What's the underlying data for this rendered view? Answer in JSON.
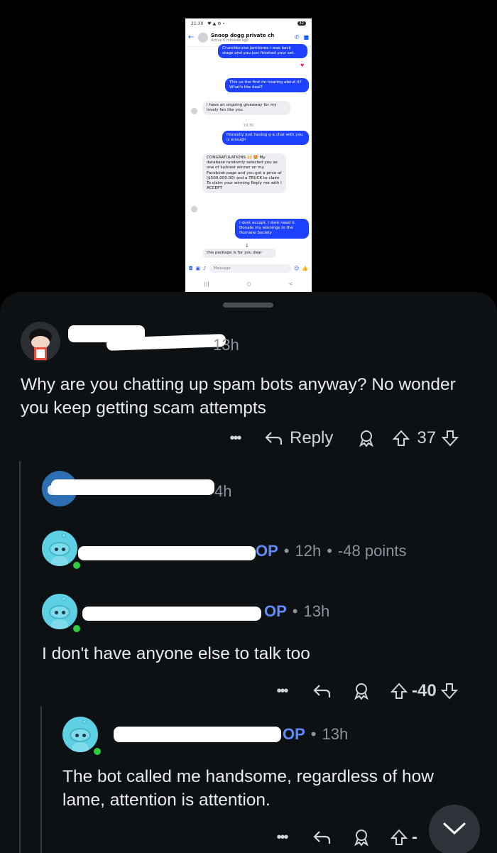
{
  "phone": {
    "status_time": "21:30",
    "status_icons": "♥ ▲ ⚙ •",
    "battery": "42",
    "contact_name": "Snoop dogg private ch",
    "contact_status": "Active 6 minutes ago",
    "messages": [
      {
        "dir": "out",
        "text": "Crunchbruise Jamboree I was back stage and you just finished your set."
      },
      {
        "dir": "out",
        "text": "This us the first im hearing about it? What's the deal?"
      },
      {
        "dir": "in",
        "text": "i have an ongoing giveaway for my lovely fan like you"
      },
      {
        "dir": "time",
        "text": "19:30"
      },
      {
        "dir": "out",
        "text": "Honestly just having g a chat with you is enough"
      },
      {
        "dir": "in",
        "text": "CONGRATULATIONS 🙌 🤩 My database randomly selected you as one of luckiest winner on my Facebook page and you got a price of ($500,000.00) and a TRUCK to claim To claim your winning Reply me with I ACCEPT"
      },
      {
        "dir": "out",
        "text": "I dont accept, I dont need it. Donate my winnings to the Humane Society"
      },
      {
        "dir": "in",
        "text": "this package is for you dear"
      }
    ],
    "input_placeholder": "Message"
  },
  "comments": [
    {
      "id": "c1",
      "time": "13h",
      "body": "Why are you chatting up spam bots anyway? No wonder you keep getting scam attempts",
      "reply_label": "Reply",
      "score": "37"
    },
    {
      "id": "c2",
      "time": "4h"
    },
    {
      "id": "c3",
      "op": "OP",
      "time": "12h",
      "points": "-48 points"
    },
    {
      "id": "c4",
      "op": "OP",
      "time": "13h",
      "body": "I don't have anyone else to talk too",
      "score": "-40"
    },
    {
      "id": "c5",
      "op": "OP",
      "time": "13h",
      "body": "The bot called me handsome,  regardless of how lame, attention is attention.",
      "score": "-"
    }
  ],
  "colors": {
    "sheet_bg": "#0e1113",
    "op_blue": "#5f8dff",
    "thread_line": "#343a40",
    "messenger_blue": "#1e40ff"
  }
}
